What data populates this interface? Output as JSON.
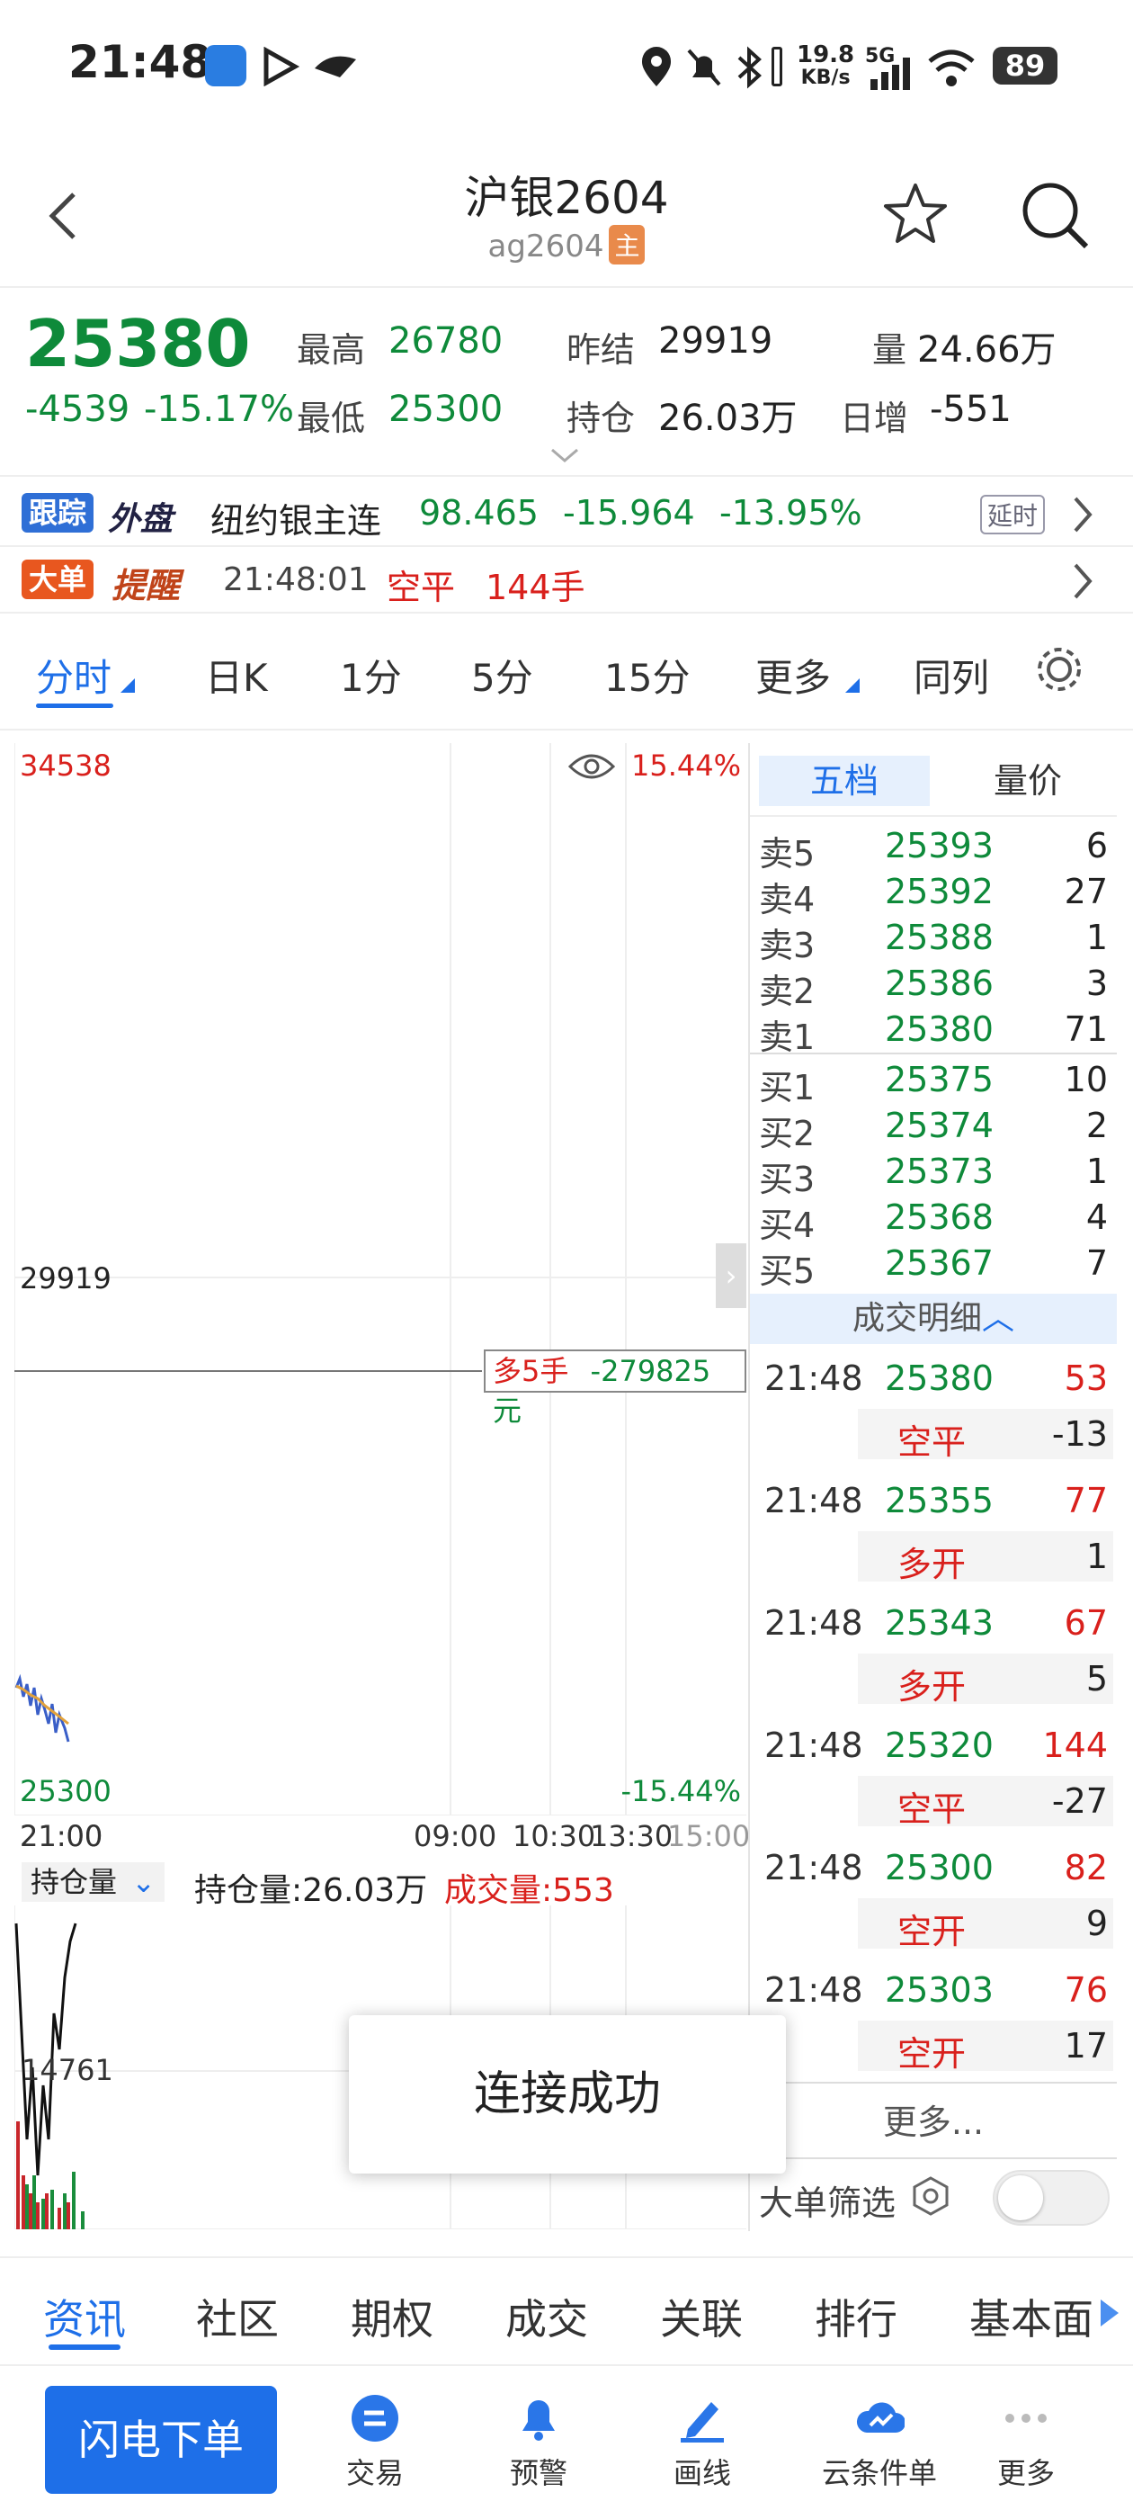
{
  "status_bar": {
    "time": "21:48",
    "net_speed_top": "19.8",
    "net_speed_unit": "KB/s",
    "signal": "5G",
    "battery": "89"
  },
  "header": {
    "title": "沪银2604",
    "code": "ag2604",
    "badge": "主"
  },
  "quote": {
    "last": "25380",
    "change": "-4539",
    "change_pct": "-15.17%",
    "high_label": "最高",
    "high": "26780",
    "low_label": "最低",
    "low": "25300",
    "prev_settle_label": "昨结",
    "prev_settle": "29919",
    "oi_label": "持仓",
    "oi": "26.03万",
    "volume_label": "量",
    "volume": "24.66万",
    "daily_inc_label": "日增",
    "daily_inc": "-551"
  },
  "outer": {
    "tag1": "跟踪",
    "tag2": "外盘",
    "name": "纽约银主连",
    "price": "98.465",
    "change": "-15.964",
    "pct": "-13.95%",
    "delay": "延时"
  },
  "alert": {
    "tag1": "大单",
    "tag2": "提醒",
    "time": "21:48:01",
    "action": "空平",
    "lots": "144手"
  },
  "chart_tabs": [
    "分时",
    "日K",
    "1分",
    "5分",
    "15分",
    "更多",
    "同列"
  ],
  "chart": {
    "top_price": "34538",
    "mid_price": "29919",
    "bottom_price": "25300",
    "top_pct": "15.44%",
    "bottom_pct": "-15.44%",
    "time_labels": [
      "21:00",
      "09:00",
      "10:30",
      "13:30",
      "15:00"
    ],
    "position_tag": "多5手",
    "position_pnl": "-279825元",
    "vol_selector": "持仓量",
    "oi_text": "持仓量:26.03万",
    "trade_vol_text": "成交量:553",
    "vol_axis_label": "14761"
  },
  "orderbook": {
    "tab_active": "五档",
    "tab_other": "量价",
    "asks": [
      {
        "label": "卖5",
        "price": "25393",
        "vol": "6"
      },
      {
        "label": "卖4",
        "price": "25392",
        "vol": "27"
      },
      {
        "label": "卖3",
        "price": "25388",
        "vol": "1"
      },
      {
        "label": "卖2",
        "price": "25386",
        "vol": "3"
      },
      {
        "label": "卖1",
        "price": "25380",
        "vol": "71"
      }
    ],
    "bids": [
      {
        "label": "买1",
        "price": "25375",
        "vol": "10"
      },
      {
        "label": "买2",
        "price": "25374",
        "vol": "2"
      },
      {
        "label": "买3",
        "price": "25373",
        "vol": "1"
      },
      {
        "label": "买4",
        "price": "25368",
        "vol": "4"
      },
      {
        "label": "买5",
        "price": "25367",
        "vol": "7"
      }
    ],
    "detail_title": "成交明细",
    "trades": [
      {
        "time": "21:48",
        "price": "25380",
        "vol": "53",
        "type": "空平",
        "oi": "-13"
      },
      {
        "time": "21:48",
        "price": "25355",
        "vol": "77",
        "type": "多开",
        "oi": "1"
      },
      {
        "time": "21:48",
        "price": "25343",
        "vol": "67",
        "type": "多开",
        "oi": "5"
      },
      {
        "time": "21:48",
        "price": "25320",
        "vol": "144",
        "type": "空平",
        "oi": "-27"
      },
      {
        "time": "21:48",
        "price": "25300",
        "vol": "82",
        "type": "空开",
        "oi": "9"
      },
      {
        "time": "21:48",
        "price": "25303",
        "vol": "76",
        "type": "空开",
        "oi": "17"
      }
    ],
    "more": "更多...",
    "filter": "大单筛选"
  },
  "toast": "连接成功",
  "info_tabs": [
    "资讯",
    "社区",
    "期权",
    "成交",
    "关联",
    "排行",
    "基本面"
  ],
  "bottom_nav": {
    "flash_order": "闪电下单",
    "items": [
      "交易",
      "预警",
      "画线",
      "云条件单",
      "更多"
    ]
  },
  "colors": {
    "up": "#d9201c",
    "down": "#0e8a3a",
    "accent": "#1e6fe8"
  }
}
